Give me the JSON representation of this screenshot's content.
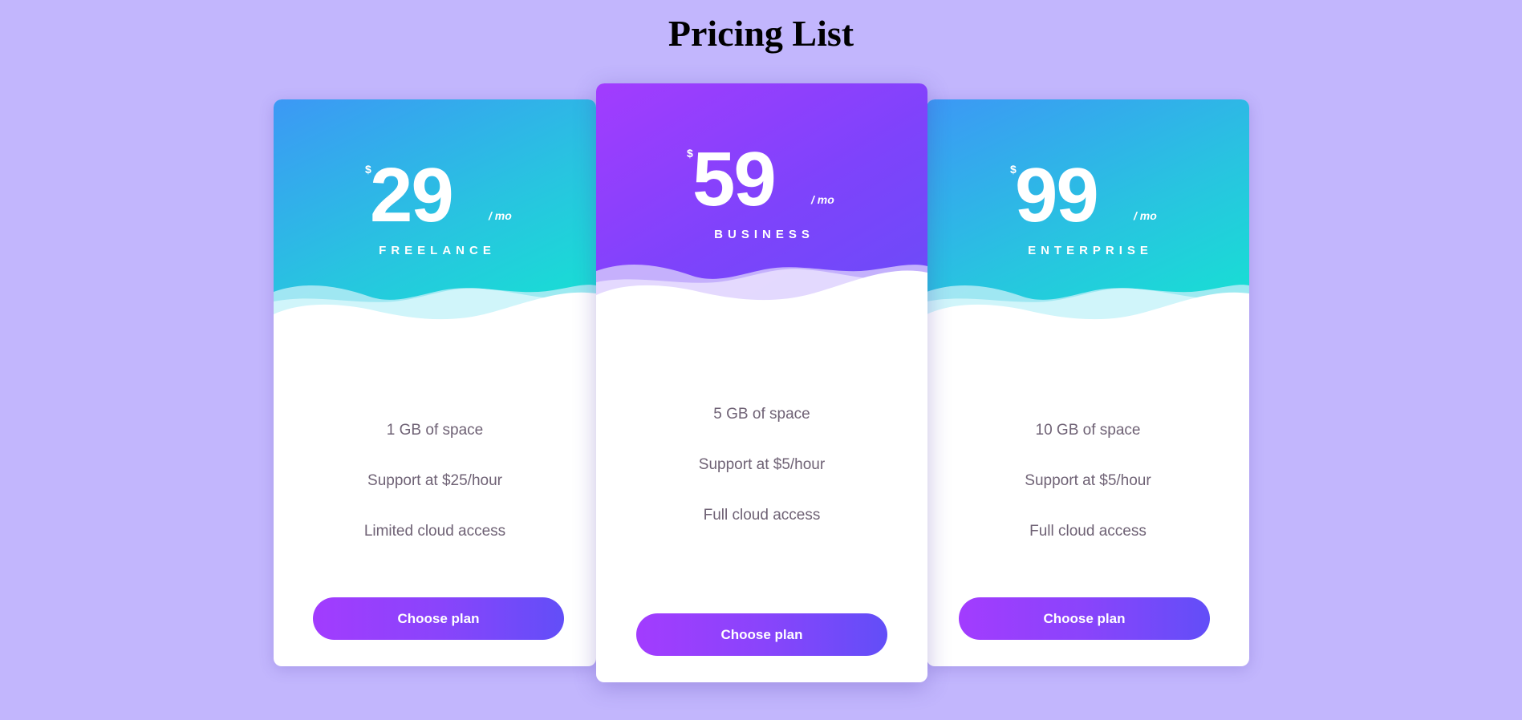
{
  "page": {
    "title": "Pricing List",
    "background": "#c2b6fd"
  },
  "plans": [
    {
      "id": "freelance",
      "currency": "$",
      "price": "29",
      "period": "/ mo",
      "name": "FREELANCE",
      "theme": "teal",
      "features": [
        "1 GB of space",
        "Support at $25/hour",
        "Limited cloud access"
      ],
      "button_label": "Choose plan",
      "featured": false
    },
    {
      "id": "business",
      "currency": "$",
      "price": "59",
      "period": "/ mo",
      "name": "BUSINESS",
      "theme": "purple",
      "features": [
        "5 GB of space",
        "Support at $5/hour",
        "Full cloud access"
      ],
      "button_label": "Choose plan",
      "featured": true
    },
    {
      "id": "enterprise",
      "currency": "$",
      "price": "99",
      "period": "/ mo",
      "name": "ENTERPRISE",
      "theme": "teal",
      "features": [
        "10 GB of space",
        "Support at $5/hour",
        "Full cloud access"
      ],
      "button_label": "Choose plan",
      "featured": false
    }
  ],
  "colors": {
    "teal_gradient": [
      "#3c98f5",
      "#15e3d2"
    ],
    "purple_gradient": [
      "#a23cfe",
      "#6a4cf8"
    ],
    "button_gradient": [
      "#a23cfe",
      "#624ef8"
    ],
    "feature_text": "#6f6275"
  }
}
